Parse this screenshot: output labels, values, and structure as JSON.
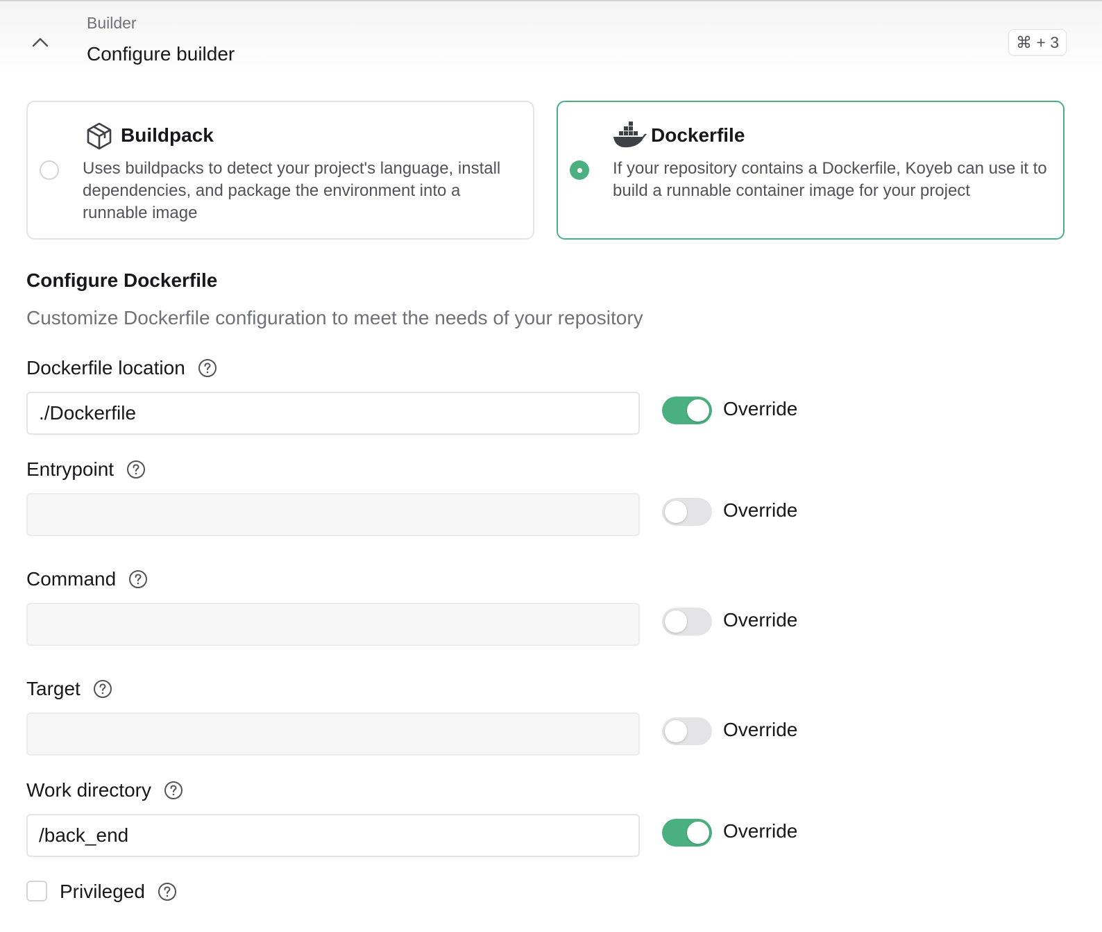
{
  "header": {
    "eyebrow": "Builder",
    "title": "Configure builder",
    "shortcut": "⌘ + 3"
  },
  "builder_options": [
    {
      "title": "Buildpack",
      "description": "Uses buildpacks to detect your project's language, install dependencies, and package the environment into a runnable image",
      "selected": false,
      "icon": "package-box-icon"
    },
    {
      "title": "Dockerfile",
      "description": "If your repository contains a Dockerfile, Koyeb can use it to build a runnable container image for your project",
      "selected": true,
      "icon": "docker-whale-icon"
    }
  ],
  "section": {
    "title": "Configure Dockerfile",
    "description": "Customize Dockerfile configuration to meet the needs of your repository"
  },
  "fields": [
    {
      "label": "Dockerfile location",
      "value": "./Dockerfile",
      "override": true,
      "override_label": "Override"
    },
    {
      "label": "Entrypoint",
      "value": "",
      "override": false,
      "override_label": "Override"
    },
    {
      "label": "Command",
      "value": "",
      "override": false,
      "override_label": "Override"
    },
    {
      "label": "Target",
      "value": "",
      "override": false,
      "override_label": "Override"
    },
    {
      "label": "Work directory",
      "value": "/back_end",
      "override": true,
      "override_label": "Override"
    }
  ],
  "privileged": {
    "label": "Privileged",
    "checked": false
  },
  "colors": {
    "accent": "#4bb07f",
    "border": "#e4e4e7",
    "muted_text": "#71717a"
  }
}
